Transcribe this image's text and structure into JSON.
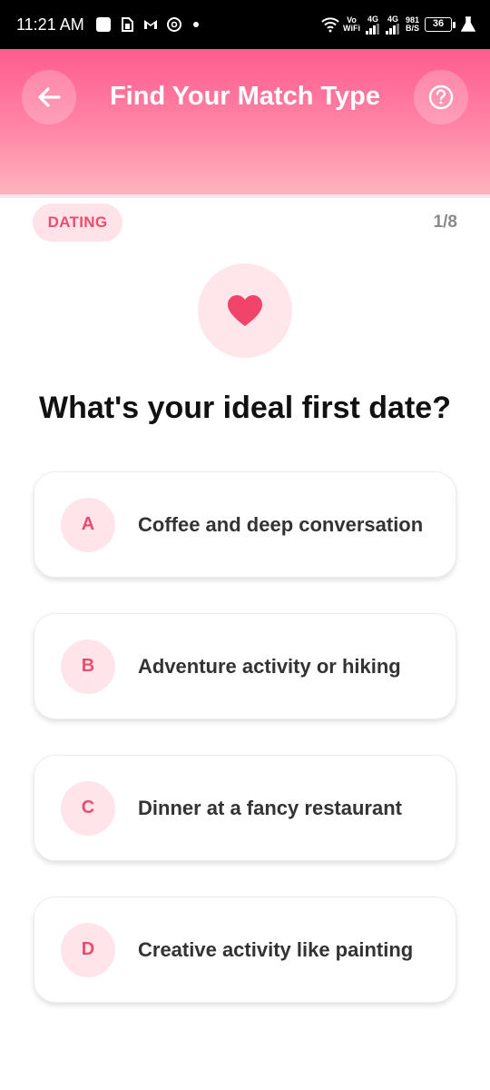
{
  "status_bar": {
    "time": "11:21 AM",
    "network_top": "Vo",
    "network_bottom": "WiFi",
    "signal1_label": "4G",
    "signal2_label": "4G",
    "speed_value": "981",
    "speed_unit": "B/S",
    "battery": "36"
  },
  "header": {
    "title": "Find Your Match Type",
    "back_icon": "arrow-left-icon",
    "help_icon": "help-circle-icon",
    "gradient_top": "#ff5c8e",
    "gradient_bottom": "#ffb3bf"
  },
  "quiz": {
    "category": "DATING",
    "progress": "1/8",
    "icon": "heart-icon",
    "accent": "#f0446a",
    "question": "What's your ideal first date?",
    "options": [
      {
        "letter": "A",
        "text": "Coffee and deep conversation"
      },
      {
        "letter": "B",
        "text": "Adventure activity or hiking"
      },
      {
        "letter": "C",
        "text": "Dinner at a fancy restaurant"
      },
      {
        "letter": "D",
        "text": "Creative activity like painting"
      }
    ]
  }
}
